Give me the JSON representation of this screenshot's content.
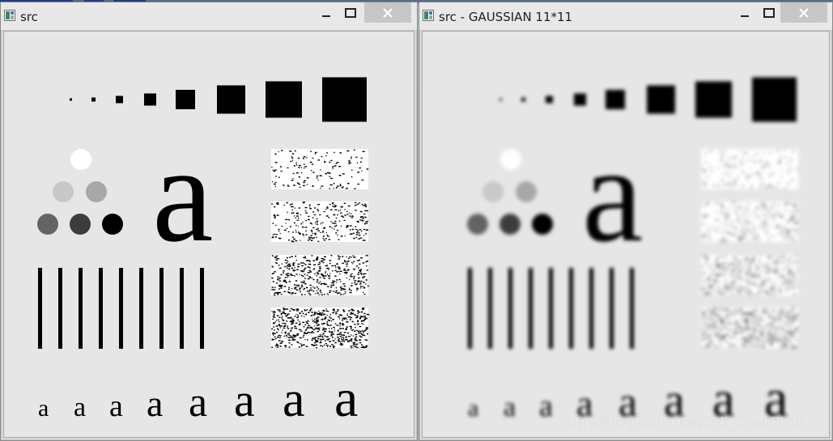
{
  "windows": [
    {
      "id": "left",
      "title": "src",
      "blurred": false
    },
    {
      "id": "right",
      "title": "src - GAUSSIAN 11*11",
      "blurred": true
    }
  ],
  "test_pattern": {
    "big_letter": "a",
    "small_letter": "a",
    "gray_levels": [
      "#ffffff",
      "#c8c8c8",
      "#a8a8a8",
      "#646464",
      "#3c3c3c",
      "#000000"
    ]
  },
  "watermark": "http://blog.csdn.net/Stk_OverFlow",
  "icons": {
    "app": "opencv-window-icon",
    "minimize": "minimize-icon",
    "maximize": "maximize-icon",
    "close": "close-icon"
  }
}
